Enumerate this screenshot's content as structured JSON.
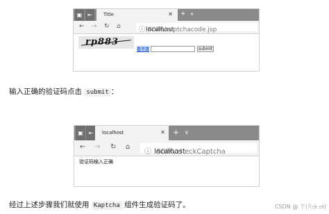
{
  "screenshot1": {
    "tab_title": "Title",
    "tab_close": "✕",
    "new_tab": "+",
    "tab_menu": "∨",
    "url_host": "localhost",
    "url_path": ":8080/captchacode.jsp",
    "captcha_text": "rp883",
    "refresh_link": "看不清",
    "code_input_value": "",
    "submit_label": "submit"
  },
  "caption1": {
    "before": "输入正确的验证码点击",
    "code": "submit",
    "after": "："
  },
  "screenshot2": {
    "tab_title": "localhost",
    "tab_close": "✕",
    "new_tab": "+",
    "tab_menu": "∨",
    "url_host": "localhost",
    "url_path": ":8080/checkCaptcha",
    "result_text": "验证码输入正确"
  },
  "caption2": {
    "before": "经过上述步骤我们就使用",
    "code": "Kaptcha",
    "after": "组件生成验证码了。"
  },
  "watermark": "CSDN @ 丫(ꐦ▭̴̀ ▭̴́)"
}
